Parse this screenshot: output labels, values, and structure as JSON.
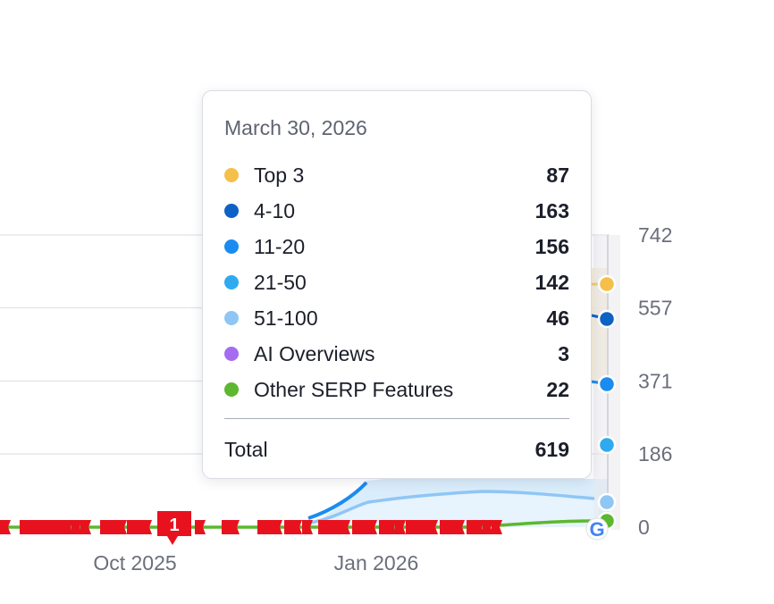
{
  "chart_data": {
    "type": "area",
    "y_axis": {
      "ticks": [
        0,
        186,
        371,
        557,
        742
      ],
      "position": "right"
    },
    "x_axis": {
      "tick_labels": [
        "Oct 2025",
        "Jan 2026"
      ]
    },
    "grid": true,
    "series": [
      {
        "name": "Top 3",
        "color": "#f5c04a",
        "last_value": 87
      },
      {
        "name": "4-10",
        "color": "#0d62c5",
        "last_value": 163
      },
      {
        "name": "11-20",
        "color": "#1a8cf0",
        "last_value": 156
      },
      {
        "name": "21-50",
        "color": "#2eaaf0",
        "last_value": 142
      },
      {
        "name": "51-100",
        "color": "#8fc6f5",
        "last_value": 46
      },
      {
        "name": "AI Overviews",
        "color": "#a56cf0",
        "last_value": 3
      },
      {
        "name": "Other SERP Features",
        "color": "#5cb82e",
        "last_value": 22
      }
    ],
    "annotation_badge": "1",
    "tooltip": {
      "date": "March 30, 2026",
      "rows": [
        {
          "name": "Top 3",
          "color": "#f5c04a",
          "value": "87"
        },
        {
          "name": "4-10",
          "color": "#0d62c5",
          "value": "163"
        },
        {
          "name": "11-20",
          "color": "#1a8cf0",
          "value": "156"
        },
        {
          "name": "21-50",
          "color": "#2eaaf0",
          "value": "142"
        },
        {
          "name": "51-100",
          "color": "#8fc6f5",
          "value": "46"
        },
        {
          "name": "AI Overviews",
          "color": "#a56cf0",
          "value": "3"
        },
        {
          "name": "Other SERP Features",
          "color": "#5cb82e",
          "value": "22"
        }
      ],
      "total_label": "Total",
      "total_value": "619"
    }
  },
  "icons": {
    "google_marker": "google-g-icon",
    "note_flag": "red-flag-icon"
  }
}
